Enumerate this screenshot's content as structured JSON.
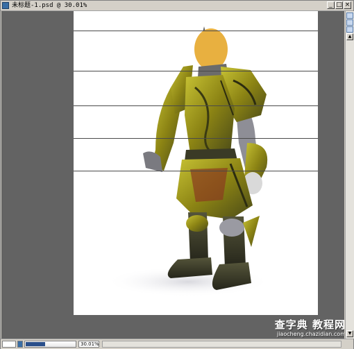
{
  "window": {
    "title": "未标题-1.psd @ 30.01%",
    "controls": {
      "minimize": "_",
      "maximize": "□",
      "close": "×"
    }
  },
  "statusbar": {
    "zoom": "30.01%"
  },
  "watermark": {
    "brand": "查字典 教程网",
    "url": "jiaocheng.chazidian.com"
  },
  "colors": {
    "canvas_bg": "#636363",
    "armor_gold": "#8c8414",
    "armor_dark": "#3a3a26",
    "skin": "#e8b040"
  },
  "icons": [
    "document-icon",
    "armored-knight-artwork",
    "palette-icon",
    "scroll-arrow-icon"
  ]
}
